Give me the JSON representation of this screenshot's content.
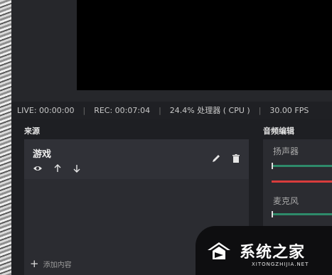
{
  "status_bar": {
    "live": "LIVE: 00:00:00",
    "rec": "REC: 00:07:04",
    "cpu": "24.4% 处理器 ( CPU )",
    "fps": "30.00 FPS",
    "separator": "|"
  },
  "sources": {
    "title": "来源",
    "items": [
      {
        "name": "游戏",
        "visible": true
      }
    ],
    "add_label": "添加内容",
    "icons": [
      "eye-icon",
      "arrow-up-icon",
      "arrow-down-icon",
      "pencil-icon",
      "trash-icon"
    ]
  },
  "audio": {
    "title": "音频编辑",
    "channels": [
      {
        "label": "扬声器"
      },
      {
        "label": "麦克风"
      }
    ]
  },
  "watermark": {
    "text": "系统之家",
    "sub": "XITONGZHIJIA.NET"
  },
  "colors": {
    "meter_green": "#2e8a6a",
    "meter_red": "#d83c3c"
  }
}
